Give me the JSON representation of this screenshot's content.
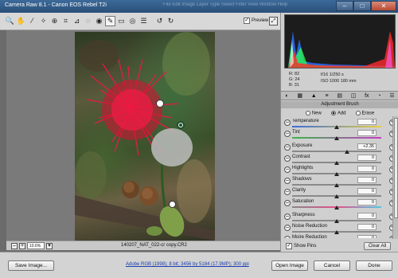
{
  "window": {
    "title": "Camera Raw 8.1  -  Canon EOS Rebel T2i",
    "menus": "File   Edit   Image   Layer   Type   Select   Filter   View   Window   Help",
    "minimize": "–",
    "maximize": "□",
    "close": "✕"
  },
  "toolbar": {
    "preview_label": "Preview",
    "preview_checked": "✓",
    "fullscreen": "⤢",
    "tools": [
      {
        "name": "zoom-tool",
        "glyph": "🔍"
      },
      {
        "name": "hand-tool",
        "glyph": "✋"
      },
      {
        "name": "white-balance-tool",
        "glyph": "⁄"
      },
      {
        "name": "color-sampler-tool",
        "glyph": "✧"
      },
      {
        "name": "targeted-adjustment-tool",
        "glyph": "⊕"
      },
      {
        "name": "crop-tool",
        "glyph": "⌗"
      },
      {
        "name": "straighten-tool",
        "glyph": "⊿"
      },
      {
        "name": "spot-removal-tool",
        "glyph": "◌"
      },
      {
        "name": "red-eye-tool",
        "glyph": "◉"
      },
      {
        "name": "adjustment-brush-tool",
        "glyph": "✎"
      },
      {
        "name": "graduated-filter-tool",
        "glyph": "▭"
      },
      {
        "name": "radial-filter-tool",
        "glyph": "◎"
      },
      {
        "name": "preferences-tool",
        "glyph": "☰"
      },
      {
        "name": "rotate-ccw-tool",
        "glyph": "↺"
      },
      {
        "name": "rotate-cw-tool",
        "glyph": "↻"
      }
    ]
  },
  "status": {
    "zoom": "10.6%",
    "zoom_out": "–",
    "zoom_in": "+",
    "filename": "140207_NAT_022-cr copy.CR2"
  },
  "readout": {
    "r": "R:    82",
    "g": "G:    24",
    "b": "B:    31",
    "aperture_shutter": "f/16    1/250 s",
    "iso_focal": "ISO 1000    180 mm"
  },
  "panel": {
    "title": "Adjustment Brush",
    "modes": {
      "new": "New",
      "add": "Add",
      "erase": "Erase"
    },
    "sliders": [
      {
        "label": "Temperature",
        "value": "0",
        "level": 0.5,
        "track": "temp"
      },
      {
        "label": "Tint",
        "value": "0",
        "level": 0.5,
        "track": "tint"
      },
      {
        "label": "Exposure",
        "value": "+2.35",
        "level": 0.62,
        "track": "gray"
      },
      {
        "label": "Contrast",
        "value": "0",
        "level": 0.5,
        "track": "gray"
      },
      {
        "label": "Highlights",
        "value": "0",
        "level": 0.5,
        "track": "gray"
      },
      {
        "label": "Shadows",
        "value": "0",
        "level": 0.5,
        "track": "gray"
      },
      {
        "label": "Clarity",
        "value": "0",
        "level": 0.5,
        "track": "gray"
      },
      {
        "label": "Saturation",
        "value": "0",
        "level": 0.5,
        "track": "sat"
      },
      {
        "label": "Sharpness",
        "value": "0",
        "level": 0.5,
        "track": "gray"
      },
      {
        "label": "Noise Reduction",
        "value": "0",
        "level": 0.5,
        "track": "gray"
      },
      {
        "label": "Moire Reduction",
        "value": "0",
        "level": 0.5,
        "track": "gray"
      }
    ],
    "show_pins": "Show Pins",
    "clear_all": "Clear All"
  },
  "footer": {
    "save": "Save Image...",
    "workflow": "Adobe RGB (1998); 8 bit; 3456 by 5184 (17.9MP); 300 ppi",
    "open": "Open Image",
    "cancel": "Cancel",
    "done": "Done"
  },
  "colors": {
    "accent": "#1a3cae",
    "flower": "#e8123a",
    "titlebar": "#2f5a87"
  }
}
